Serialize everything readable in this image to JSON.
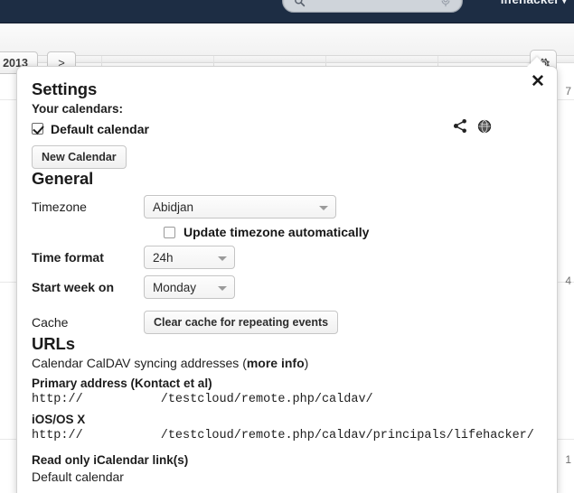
{
  "topbar": {
    "search_placeholder": "",
    "search_icon": "search-icon",
    "mic_icon": "microphone-icon",
    "user_name": "lifehacker",
    "user_caret": "▾"
  },
  "toolbar": {
    "year_label": "2013",
    "next_label": ">",
    "gear_icon": "gear-icon"
  },
  "calendar_background": {
    "day_numbers": [
      "7",
      "4",
      "1"
    ]
  },
  "popover": {
    "close_label": "✕",
    "title": "Settings",
    "calendars": {
      "heading": "Your calendars:",
      "items": [
        {
          "name": "Default calendar",
          "checked": true
        }
      ],
      "share_icon": "share-icon",
      "globe_icon": "globe-icon",
      "new_calendar_label": "New Calendar"
    },
    "general": {
      "title": "General",
      "timezone": {
        "label": "Timezone",
        "value": "Abidjan",
        "caret_icon": "chevron-down-icon"
      },
      "update_timezone": {
        "label": "Update timezone automatically",
        "checked": false
      },
      "time_format": {
        "label": "Time format",
        "value": "24h",
        "caret_icon": "chevron-down-icon"
      },
      "start_week": {
        "label": "Start week on",
        "value": "Monday",
        "caret_icon": "chevron-down-icon"
      },
      "cache": {
        "label": "Cache",
        "button_label": "Clear cache for repeating events"
      }
    },
    "urls": {
      "title": "URLs",
      "description": "Calendar CalDAV syncing addresses (",
      "description_more": "more info",
      "description_end": ")",
      "primary": {
        "heading": "Primary address (Kontact et al)",
        "scheme": "http://",
        "path": "/testcloud/remote.php/caldav/"
      },
      "ios": {
        "heading": "iOS/OS X",
        "scheme": "http://",
        "path": "/testcloud/remote.php/caldav/principals/lifehacker/"
      },
      "readonly": {
        "heading": "Read only iCalendar link(s)",
        "items": [
          "Default calendar"
        ]
      }
    }
  },
  "colors": {
    "topbar_bg": "#1d2d44",
    "panel_bg": "#ffffff",
    "text": "#1d1d1d",
    "border": "#c4c4c4"
  }
}
